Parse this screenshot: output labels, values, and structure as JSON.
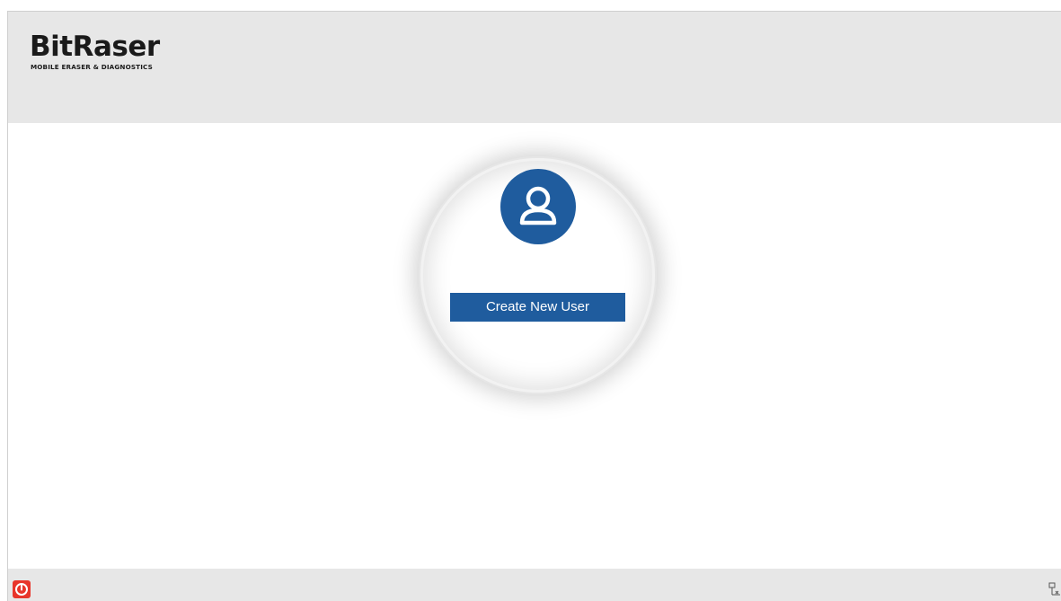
{
  "header": {
    "logo_text": "BitRaser",
    "logo_subtitle": "MOBILE ERASER & DIAGNOSTICS"
  },
  "main": {
    "avatar_icon": "user-icon",
    "create_button_label": "Create New User"
  },
  "footer": {
    "power_icon": "power-icon",
    "network_icon": "network-icon"
  },
  "colors": {
    "accent": "#1f5c9e",
    "header_bg": "#e7e7e7",
    "power_red": "#e8352a"
  }
}
